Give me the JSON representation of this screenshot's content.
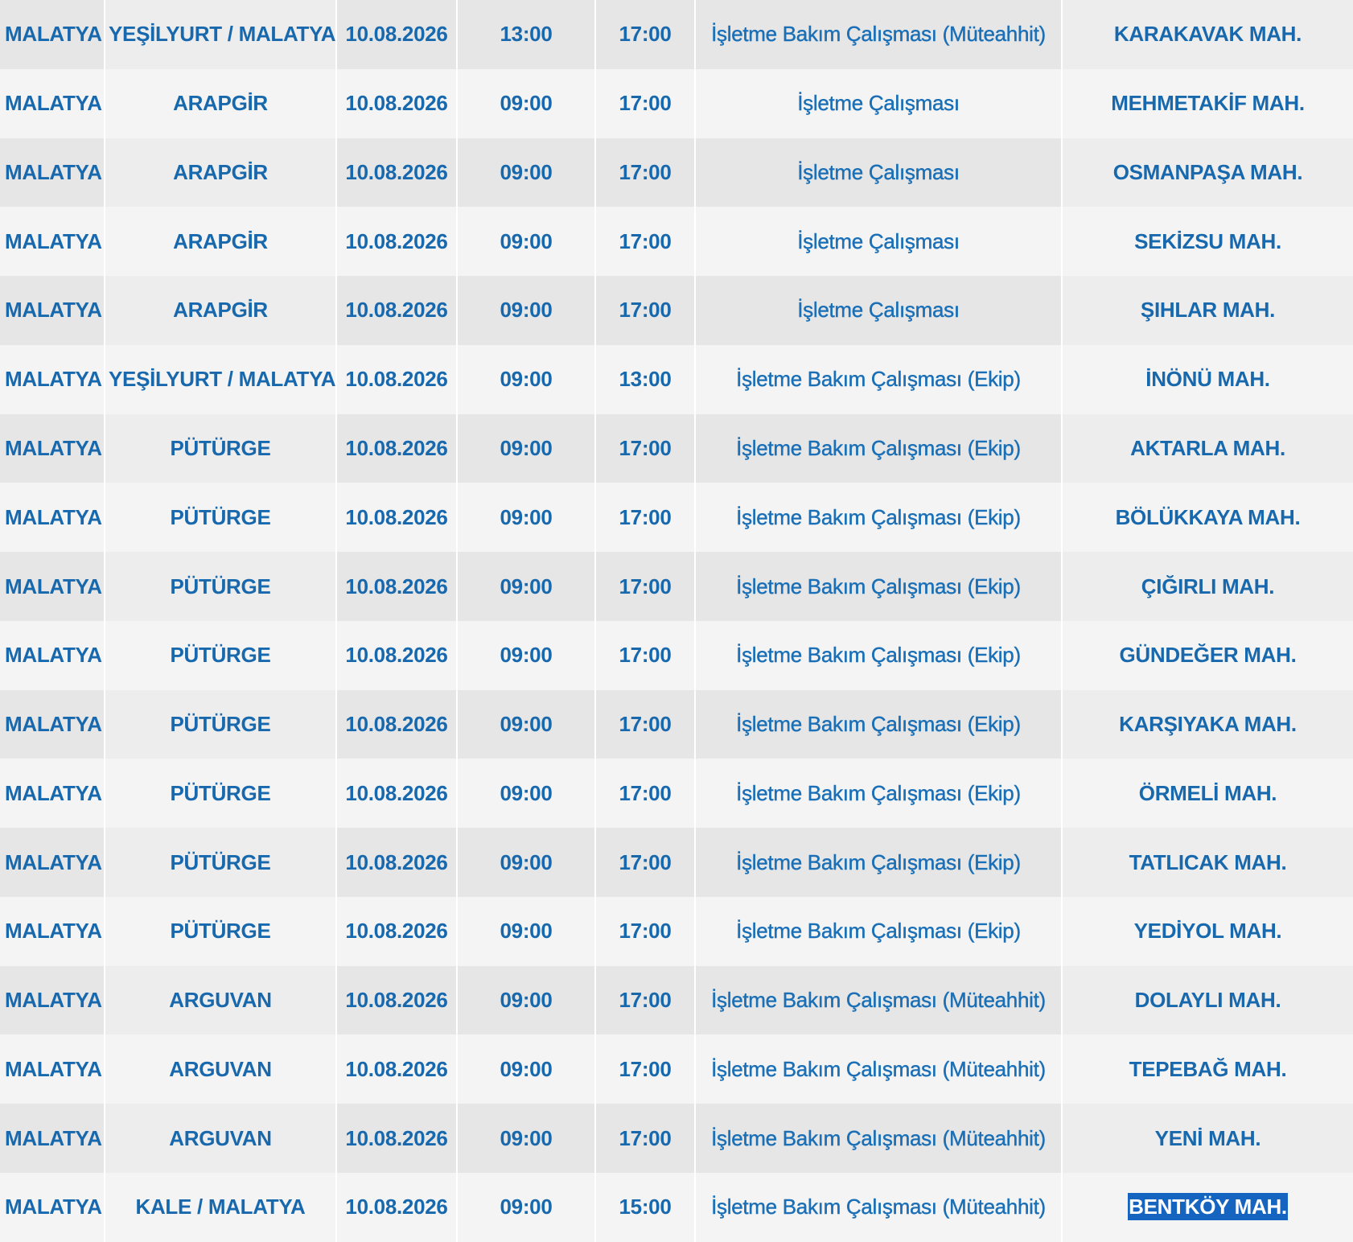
{
  "rows": [
    {
      "province": "MALATYA",
      "district": "YEŞİLYURT / MALATYA",
      "date": "10.08.2026",
      "start": "13:00",
      "end": "17:00",
      "description": "İşletme Bakım Çalışması (Müteahhit)",
      "neighborhood": "KARAKAVAK MAH."
    },
    {
      "province": "MALATYA",
      "district": "ARAPGİR",
      "date": "10.08.2026",
      "start": "09:00",
      "end": "17:00",
      "description": "İşletme Çalışması",
      "neighborhood": "MEHMETAKİF MAH."
    },
    {
      "province": "MALATYA",
      "district": "ARAPGİR",
      "date": "10.08.2026",
      "start": "09:00",
      "end": "17:00",
      "description": "İşletme Çalışması",
      "neighborhood": "OSMANPAŞA MAH."
    },
    {
      "province": "MALATYA",
      "district": "ARAPGİR",
      "date": "10.08.2026",
      "start": "09:00",
      "end": "17:00",
      "description": "İşletme Çalışması",
      "neighborhood": "SEKİZSU MAH."
    },
    {
      "province": "MALATYA",
      "district": "ARAPGİR",
      "date": "10.08.2026",
      "start": "09:00",
      "end": "17:00",
      "description": "İşletme Çalışması",
      "neighborhood": "ŞIHLAR MAH."
    },
    {
      "province": "MALATYA",
      "district": "YEŞİLYURT / MALATYA",
      "date": "10.08.2026",
      "start": "09:00",
      "end": "13:00",
      "description": "İşletme Bakım Çalışması (Ekip)",
      "neighborhood": "İNÖNÜ MAH."
    },
    {
      "province": "MALATYA",
      "district": "PÜTÜRGE",
      "date": "10.08.2026",
      "start": "09:00",
      "end": "17:00",
      "description": "İşletme Bakım Çalışması (Ekip)",
      "neighborhood": "AKTARLA MAH."
    },
    {
      "province": "MALATYA",
      "district": "PÜTÜRGE",
      "date": "10.08.2026",
      "start": "09:00",
      "end": "17:00",
      "description": "İşletme Bakım Çalışması (Ekip)",
      "neighborhood": "BÖLÜKKAYA MAH."
    },
    {
      "province": "MALATYA",
      "district": "PÜTÜRGE",
      "date": "10.08.2026",
      "start": "09:00",
      "end": "17:00",
      "description": "İşletme Bakım Çalışması (Ekip)",
      "neighborhood": "ÇIĞIRLI MAH."
    },
    {
      "province": "MALATYA",
      "district": "PÜTÜRGE",
      "date": "10.08.2026",
      "start": "09:00",
      "end": "17:00",
      "description": "İşletme Bakım Çalışması (Ekip)",
      "neighborhood": "GÜNDEĞER MAH."
    },
    {
      "province": "MALATYA",
      "district": "PÜTÜRGE",
      "date": "10.08.2026",
      "start": "09:00",
      "end": "17:00",
      "description": "İşletme Bakım Çalışması (Ekip)",
      "neighborhood": "KARŞIYAKA MAH."
    },
    {
      "province": "MALATYA",
      "district": "PÜTÜRGE",
      "date": "10.08.2026",
      "start": "09:00",
      "end": "17:00",
      "description": "İşletme Bakım Çalışması (Ekip)",
      "neighborhood": "ÖRMELİ MAH."
    },
    {
      "province": "MALATYA",
      "district": "PÜTÜRGE",
      "date": "10.08.2026",
      "start": "09:00",
      "end": "17:00",
      "description": "İşletme Bakım Çalışması (Ekip)",
      "neighborhood": "TATLICAK MAH."
    },
    {
      "province": "MALATYA",
      "district": "PÜTÜRGE",
      "date": "10.08.2026",
      "start": "09:00",
      "end": "17:00",
      "description": "İşletme Bakım Çalışması (Ekip)",
      "neighborhood": "YEDİYOL MAH."
    },
    {
      "province": "MALATYA",
      "district": "ARGUVAN",
      "date": "10.08.2026",
      "start": "09:00",
      "end": "17:00",
      "description": "İşletme Bakım Çalışması (Müteahhit)",
      "neighborhood": "DOLAYLI MAH."
    },
    {
      "province": "MALATYA",
      "district": "ARGUVAN",
      "date": "10.08.2026",
      "start": "09:00",
      "end": "17:00",
      "description": "İşletme Bakım Çalışması (Müteahhit)",
      "neighborhood": "TEPEBAĞ MAH."
    },
    {
      "province": "MALATYA",
      "district": "ARGUVAN",
      "date": "10.08.2026",
      "start": "09:00",
      "end": "17:00",
      "description": "İşletme Bakım Çalışması (Müteahhit)",
      "neighborhood": "YENİ MAH."
    },
    {
      "province": "MALATYA",
      "district": "KALE / MALATYA",
      "date": "10.08.2026",
      "start": "09:00",
      "end": "15:00",
      "description": "İşletme Bakım Çalışması (Müteahhit)",
      "neighborhood": "BENTKÖY MAH."
    }
  ],
  "selection": {
    "row": 17,
    "field": "neighborhood"
  },
  "colors": {
    "text": "#1868ad",
    "row_dark": "#e6e6e6",
    "row_light": "#f4f4f4",
    "selection_bg": "#1565c0",
    "selection_text": "#ffffff"
  }
}
